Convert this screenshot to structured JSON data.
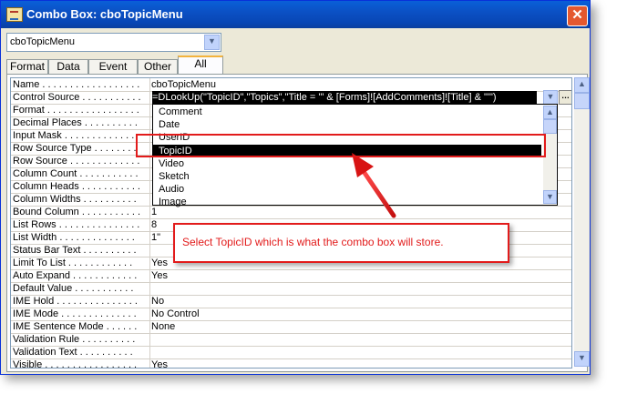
{
  "window": {
    "title": "Combo Box: cboTopicMenu",
    "close_label": "✕"
  },
  "object_selector": {
    "value": "cboTopicMenu"
  },
  "tabs": [
    {
      "label": "Format"
    },
    {
      "label": "Data"
    },
    {
      "label": "Event"
    },
    {
      "label": "Other"
    },
    {
      "label": "All",
      "active": true
    }
  ],
  "properties": [
    {
      "label": "Name . . . . . . . . . . . . . . . . . .",
      "value": "cboTopicMenu"
    },
    {
      "label": "Control Source . . . . . . . . . . .",
      "value": "=DLookUp(\"TopicID\",\"Topics\",\"Title = '\" & [Forms]![AddComments]![Title] & \"'\")"
    },
    {
      "label": "Format . . . . . . . . . . . . . . . . .",
      "value": ""
    },
    {
      "label": "Decimal Places . . . . . . . . . .",
      "value": ""
    },
    {
      "label": "Input Mask . . . . . . . . . . . . .",
      "value": ""
    },
    {
      "label": "Row Source Type . . . . . . . .",
      "value": ""
    },
    {
      "label": "Row Source . . . . . . . . . . . . .",
      "value": ""
    },
    {
      "label": "Column Count . . . . . . . . . . .",
      "value": ""
    },
    {
      "label": "Column Heads . . . . . . . . . . .",
      "value": ""
    },
    {
      "label": "Column Widths . . . . . . . . . .",
      "value": ""
    },
    {
      "label": "Bound Column . . . . . . . . . . .",
      "value": "1"
    },
    {
      "label": "List Rows . . . . . . . . . . . . . . .",
      "value": "8"
    },
    {
      "label": "List Width . . . . . . . . . . . . . .",
      "value": "1\""
    },
    {
      "label": "Status Bar Text . . . . . . . . . .",
      "value": ""
    },
    {
      "label": "Limit To List . . . . . . . . . . . .",
      "value": "Yes"
    },
    {
      "label": "Auto Expand . . . . . . . . . . . .",
      "value": "Yes"
    },
    {
      "label": "Default Value . . . . . . . . . . .",
      "value": ""
    },
    {
      "label": "IME Hold . . . . . . . . . . . . . . .",
      "value": "No"
    },
    {
      "label": "IME Mode . . . . . . . . . . . . . .",
      "value": "No Control"
    },
    {
      "label": "IME Sentence Mode . . . . . .",
      "value": "None"
    },
    {
      "label": "Validation Rule . . . . . . . . . .",
      "value": ""
    },
    {
      "label": "Validation Text . . . . . . . . . .",
      "value": ""
    },
    {
      "label": "Visible . . . . . . . . . . . . . . . . .",
      "value": "Yes"
    }
  ],
  "dropdown_items": [
    "Comment",
    "Date",
    "UserID",
    "TopicID",
    "Video",
    "Sketch",
    "Audio",
    "Image"
  ],
  "dropdown_selected": "TopicID",
  "callout": {
    "text": "Select TopicID which is what the combo box will store."
  },
  "icons": {
    "close": "close-icon",
    "dropdown": "chevron-down-icon",
    "builder": "ellipsis-icon"
  },
  "colors": {
    "titlebar": "#0b4fc2",
    "annotation": "#e21b1b",
    "selection": "#000000"
  }
}
